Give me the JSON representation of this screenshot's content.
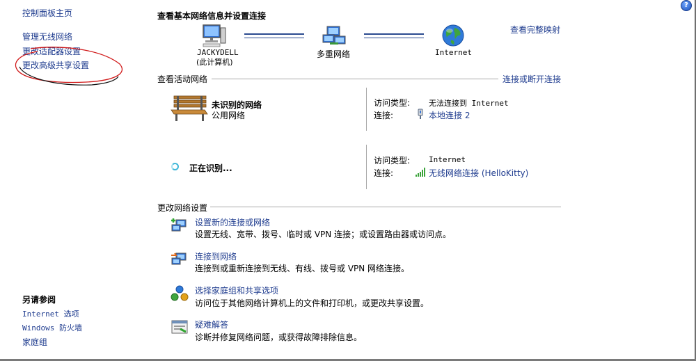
{
  "sidebar": {
    "home": "控制面板主页",
    "links": [
      "管理无线网络",
      "更改适配器设置",
      "更改高级共享设置"
    ],
    "see_also_title": "另请参阅",
    "see_also": [
      "Internet 选项",
      "Windows 防火墙",
      "家庭组"
    ]
  },
  "header": {
    "title": "查看基本网络信息并设置连接",
    "view_full_map": "查看完整映射"
  },
  "map": {
    "computer_name": "JACKYDELL",
    "computer_sub": "(此计算机)",
    "middle_label": "多重网络",
    "internet_label": "Internet"
  },
  "active": {
    "title": "查看活动网络",
    "connect_link": "连接或断开连接",
    "networks": [
      {
        "name": "未识别的网络",
        "category": "公用网络",
        "access_label": "访问类型:",
        "access_value": "无法连接到 Internet",
        "conn_label": "连接:",
        "conn_value": "本地连接 2"
      },
      {
        "name": "正在识别...",
        "access_label": "访问类型:",
        "access_value": "Internet",
        "conn_label": "连接:",
        "conn_value": "无线网络连接 (HelloKitty)"
      }
    ]
  },
  "change": {
    "title": "更改网络设置",
    "items": [
      {
        "title": "设置新的连接或网络",
        "desc": "设置无线、宽带、拨号、临时或 VPN 连接；或设置路由器或访问点。"
      },
      {
        "title": "连接到网络",
        "desc": "连接到或重新连接到无线、有线、拨号或 VPN 网络连接。"
      },
      {
        "title": "选择家庭组和共享选项",
        "desc": "访问位于其他网络计算机上的文件和打印机，或更改共享设置。"
      },
      {
        "title": "疑难解答",
        "desc": "诊断并修复网络问题，或获得故障排除信息。"
      }
    ]
  },
  "help_glyph": "?"
}
